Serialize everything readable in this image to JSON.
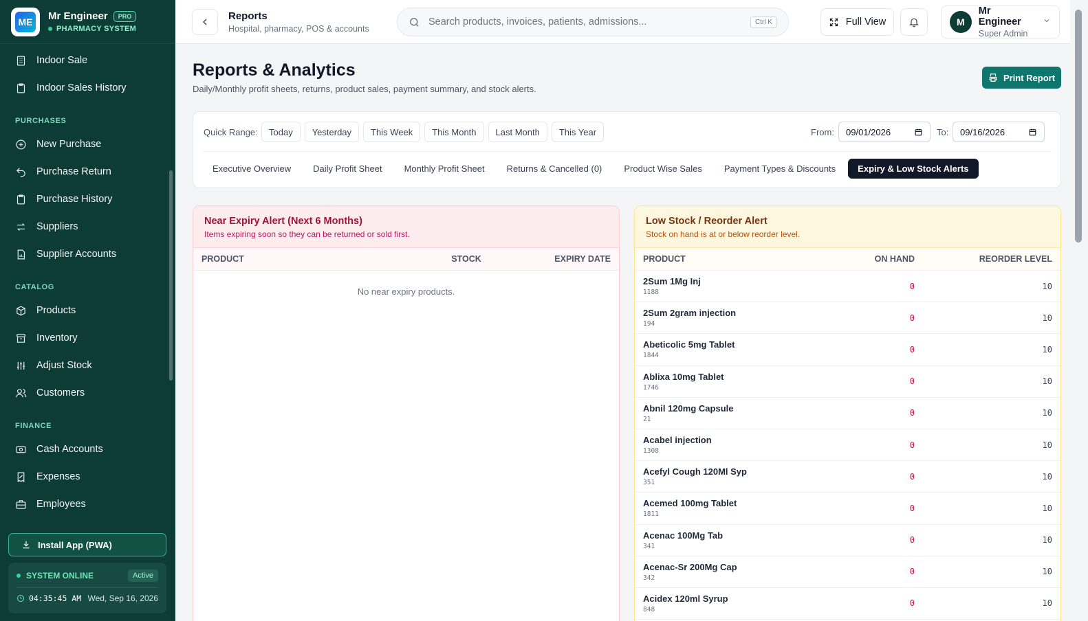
{
  "brand": {
    "name": "Mr Engineer",
    "badge": "PRO",
    "subtitle": "PHARMACY SYSTEM",
    "logo_text": "ME"
  },
  "sidebar": {
    "items_top": [
      {
        "label": "Indoor Sale",
        "icon": "building-icon"
      },
      {
        "label": "Indoor Sales History",
        "icon": "clipboard-icon"
      }
    ],
    "sections": [
      {
        "title": "PURCHASES",
        "items": [
          {
            "label": "New Purchase",
            "icon": "plus-circle-icon"
          },
          {
            "label": "Purchase Return",
            "icon": "return-icon"
          },
          {
            "label": "Purchase History",
            "icon": "clipboard-icon"
          },
          {
            "label": "Suppliers",
            "icon": "swap-icon"
          },
          {
            "label": "Supplier Accounts",
            "icon": "file-chart-icon"
          }
        ]
      },
      {
        "title": "CATALOG",
        "items": [
          {
            "label": "Products",
            "icon": "box-icon"
          },
          {
            "label": "Inventory",
            "icon": "archive-icon"
          },
          {
            "label": "Adjust Stock",
            "icon": "sliders-icon"
          },
          {
            "label": "Customers",
            "icon": "users-icon"
          }
        ]
      },
      {
        "title": "FINANCE",
        "items": [
          {
            "label": "Cash Accounts",
            "icon": "cash-icon"
          },
          {
            "label": "Expenses",
            "icon": "receipt-icon"
          },
          {
            "label": "Employees",
            "icon": "briefcase-icon"
          }
        ]
      }
    ],
    "install_label": "Install App (PWA)",
    "status": {
      "label": "SYSTEM ONLINE",
      "badge": "Active",
      "time": "04:35:45 AM",
      "date": "Wed, Sep 16, 2026"
    }
  },
  "topbar": {
    "title": "Reports",
    "subtitle": "Hospital, pharmacy, POS & accounts",
    "search_placeholder": "Search products, invoices, patients, admissions...",
    "search_kbd": "Ctrl K",
    "fullview_label": "Full View",
    "user": {
      "initial": "M",
      "name": "Mr Engineer",
      "role": "Super Admin"
    }
  },
  "page": {
    "title": "Reports & Analytics",
    "subtitle": "Daily/Monthly profit sheets, returns, product sales, payment summary, and stock alerts.",
    "print_label": "Print Report"
  },
  "filters": {
    "quick_range_label": "Quick Range:",
    "quick_ranges": [
      "Today",
      "Yesterday",
      "This Week",
      "This Month",
      "Last Month",
      "This Year"
    ],
    "from_label": "From:",
    "from_value": "09/01/2026",
    "to_label": "To:",
    "to_value": "09/16/2026",
    "tabs": [
      "Executive Overview",
      "Daily Profit Sheet",
      "Monthly Profit Sheet",
      "Returns & Cancelled (0)",
      "Product Wise Sales",
      "Payment Types & Discounts",
      "Expiry & Low Stock Alerts"
    ],
    "active_tab": "Expiry & Low Stock Alerts"
  },
  "expiry_panel": {
    "title": "Near Expiry Alert (Next 6 Months)",
    "subtitle": "Items expiring soon so they can be returned or sold first.",
    "columns": [
      "PRODUCT",
      "STOCK",
      "EXPIRY DATE"
    ],
    "empty_message": "No near expiry products."
  },
  "stock_panel": {
    "title": "Low Stock / Reorder Alert",
    "subtitle": "Stock on hand is at or below reorder level.",
    "columns": [
      "PRODUCT",
      "ON HAND",
      "REORDER LEVEL"
    ],
    "rows": [
      {
        "name": "2Sum 1Mg Inj",
        "code": "1188",
        "on_hand": "0",
        "reorder": "10"
      },
      {
        "name": "2Sum 2gram injection",
        "code": "194",
        "on_hand": "0",
        "reorder": "10"
      },
      {
        "name": "Abeticolic 5mg Tablet",
        "code": "1844",
        "on_hand": "0",
        "reorder": "10"
      },
      {
        "name": "Ablixa 10mg Tablet",
        "code": "1746",
        "on_hand": "0",
        "reorder": "10"
      },
      {
        "name": "Abnil 120mg Capsule",
        "code": "21",
        "on_hand": "0",
        "reorder": "10"
      },
      {
        "name": "Acabel injection",
        "code": "1308",
        "on_hand": "0",
        "reorder": "10"
      },
      {
        "name": "Acefyl Cough 120Ml Syp",
        "code": "351",
        "on_hand": "0",
        "reorder": "10"
      },
      {
        "name": "Acemed 100mg Tablet",
        "code": "1811",
        "on_hand": "0",
        "reorder": "10"
      },
      {
        "name": "Acenac 100Mg Tab",
        "code": "341",
        "on_hand": "0",
        "reorder": "10"
      },
      {
        "name": "Acenac-Sr 200Mg Cap",
        "code": "342",
        "on_hand": "0",
        "reorder": "10"
      },
      {
        "name": "Acidex 120ml Syrup",
        "code": "848",
        "on_hand": "0",
        "reorder": "10"
      }
    ]
  },
  "colors": {
    "sidebar_bg": "#0d3b36",
    "accent": "#0f766e",
    "alert_red": "#be123c",
    "active_tab": "#111827"
  }
}
